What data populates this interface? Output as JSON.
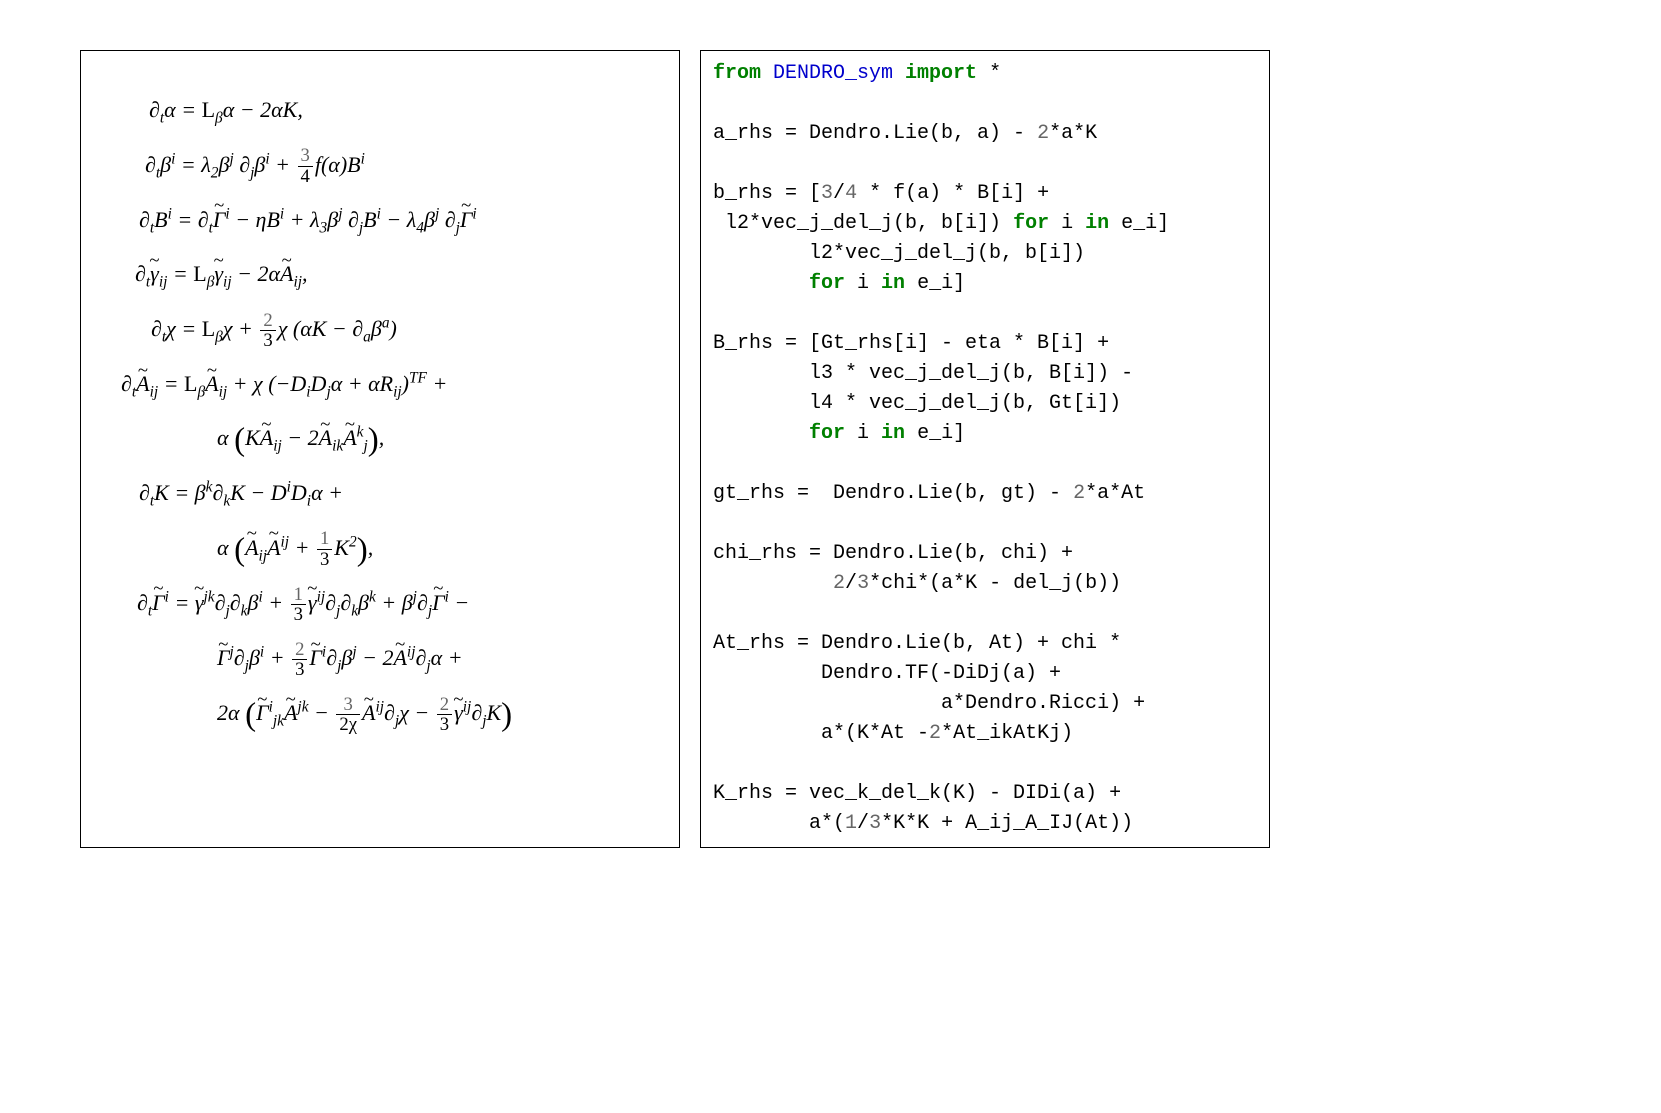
{
  "math": {
    "l1_lhs": "∂",
    "l1_t": "t",
    "l1_alpha": "α",
    "l1_eq": " = ",
    "l1_lie": "L",
    "l1_beta": "β",
    "l1_alpha2": "α − 2αK,",
    "l2_lhs": "∂",
    "l2_t": "t",
    "l2_beta": "β",
    "l2_i": "i",
    "l2_eq": " = λ",
    "l2_2": "2",
    "l2_bj": "β",
    "l2_j": "j",
    "l2_dj": " ∂",
    "l2_j2": "j",
    "l2_bi2": "β",
    "l2_i2": "i",
    "l2_plus": " + ",
    "l2_fn": "3",
    "l2_fd": "4",
    "l2_fa": "f(α)B",
    "l2_i3": "i",
    "l3_lhs": "∂",
    "l3_t": "t",
    "l3_B": "B",
    "l3_i": "i",
    "l3_eq": " = ∂",
    "l3_t2": "t",
    "l3_G": "Γ",
    "l3_i2": "i",
    "l3_mid": " − ηB",
    "l3_i3": "i",
    "l3_l3": " + λ",
    "l3_3": "3",
    "l3_bj": "β",
    "l3_j": "j",
    "l3_dj": " ∂",
    "l3_j2": "j",
    "l3_Bi": "B",
    "l3_i4": "i",
    "l3_l4": " − λ",
    "l3_4": "4",
    "l3_bj2": "β",
    "l3_j3": "j",
    "l3_dj2": " ∂",
    "l3_j4": "j",
    "l3_G2": "Γ",
    "l3_i5": "i",
    "l4_lhs": "∂",
    "l4_t": "t",
    "l4_g": "γ",
    "l4_ij": "ij",
    "l4_eq": " = ",
    "l4_lie": "L",
    "l4_beta": "β",
    "l4_g2": "γ",
    "l4_ij2": "ij",
    "l4_mid": " − 2α",
    "l4_A": "A",
    "l4_ij3": "ij",
    "l4_end": ",",
    "l5_lhs": "∂",
    "l5_t": "t",
    "l5_chi": "χ = ",
    "l5_lie": "L",
    "l5_beta": "β",
    "l5_chi2": "χ + ",
    "l5_fn": "2",
    "l5_fd": "3",
    "l5_rest": "χ (αK − ∂",
    "l5_a": "a",
    "l5_ba": "β",
    "l5_a2": "a",
    "l5_close": ")",
    "l6_lhs": "∂",
    "l6_t": "t",
    "l6_A": "A",
    "l6_ij": "ij",
    "l6_eq": " = ",
    "l6_lie": "L",
    "l6_beta": "β",
    "l6_A2": "A",
    "l6_ij2": "ij",
    "l6_mid": " + χ (−D",
    "l6_i": "i",
    "l6_D": "D",
    "l6_j": "j",
    "l6_a": "α + αR",
    "l6_ij3": "ij",
    "l6_tf": ")",
    "l6_tfsup": "TF",
    "l6_plus": " +",
    "l6b_a": "α ",
    "l6b_K": "K",
    "l6b_A": "A",
    "l6b_ij": "ij",
    "l6b_mid": " − 2",
    "l6b_A2": "A",
    "l6b_ik": "ik",
    "l6b_A3": "A",
    "l6b_k": "k",
    "l6b_j": "j",
    "l6b_end": ",",
    "l7_lhs": "∂",
    "l7_t": "t",
    "l7_K": "K = β",
    "l7_k": "k",
    "l7_dk": "∂",
    "l7_k2": "k",
    "l7_Kmid": "K − D",
    "l7_i": "i",
    "l7_D": "D",
    "l7_i2": "i",
    "l7_a": "α +",
    "l7b_a": "α ",
    "l7b_A1": "A",
    "l7b_ij": "ij",
    "l7b_A2": "A",
    "l7b_ij2": "ij",
    "l7b_plus": " + ",
    "l7b_fn": "1",
    "l7b_fd": "3",
    "l7b_K2": "K",
    "l7b_2": "2",
    "l7b_end": ",",
    "l8_lhs": "∂",
    "l8_t": "t",
    "l8_G": "Γ",
    "l8_i": "i",
    "l8_eq": " = ",
    "l8_g": "γ",
    "l8_jk": "jk",
    "l8_dj": "∂",
    "l8_j": "j",
    "l8_dk": "∂",
    "l8_k": "k",
    "l8_b": "β",
    "l8_i2": "i",
    "l8_plus": " + ",
    "l8_fn": "1",
    "l8_fd": "3",
    "l8_g2": "γ",
    "l8_ij": "ij",
    "l8_dj2": "∂",
    "l8_j2": "j",
    "l8_dk2": "∂",
    "l8_k2": "k",
    "l8_b2": "β",
    "l8_k3": "k",
    "l8_plus2": " + β",
    "l8_j3": "j",
    "l8_dj3": "∂",
    "l8_j4": "j",
    "l8_G2": "Γ",
    "l8_i3": "i",
    "l8_minus": " −",
    "l8b_G": "Γ",
    "l8b_j": "j",
    "l8b_dj": "∂",
    "l8b_j2": "j",
    "l8b_b": "β",
    "l8b_i": "i",
    "l8b_plus": " + ",
    "l8b_fn": "2",
    "l8b_fd": "3",
    "l8b_G2": "Γ",
    "l8b_i2": "i",
    "l8b_dj2": "∂",
    "l8b_j3": "j",
    "l8b_b2": "β",
    "l8b_j4": "j",
    "l8b_mid": " − 2",
    "l8b_A": "A",
    "l8b_ij": "ij",
    "l8b_dj3": "∂",
    "l8b_j5": "j",
    "l8b_a": "α +",
    "l8c_2a": "2α ",
    "l8c_G": "Γ",
    "l8c_i": "i",
    "l8c_jk": "jk",
    "l8c_A": "A",
    "l8c_jk2": "jk",
    "l8c_minus": " − ",
    "l8c_fn1": "3",
    "l8c_fd1": "2χ",
    "l8c_A2": "A",
    "l8c_ij": "ij",
    "l8c_dj": "∂",
    "l8c_j": "j",
    "l8c_chi": "χ − ",
    "l8c_fn2": "2",
    "l8c_fd2": "3",
    "l8c_g": "γ",
    "l8c_ij2": "ij",
    "l8c_dj2": "∂",
    "l8c_j2": "j",
    "l8c_K": "K"
  },
  "code": {
    "l01_from": "from ",
    "l01_mod": "DENDRO_sym ",
    "l01_import": "import ",
    "l01_star": "*",
    "l02": "",
    "l03a": "a_rhs = Dendro.Lie(b, a) - ",
    "l03n": "2",
    "l03b": "*a*K",
    "l04": "",
    "l05a": "b_rhs = [",
    "l05n1": "3",
    "l05s": "/",
    "l05n2": "4",
    "l05b": " * f(a) * B[i] +",
    "l06a": " l2*vec_j_del_j(b, b[i]) ",
    "l06for": "for",
    "l06sp": " i ",
    "l06in": "in",
    "l06b": " e_i]",
    "l07a": "        l2*vec_j_del_j(b, b[i])",
    "l08sp": "        ",
    "l08for": "for",
    "l08a": " i ",
    "l08in": "in",
    "l08b": " e_i]",
    "l09": "",
    "l10a": "B_rhs = [Gt_rhs[i] - eta * B[i] +",
    "l11a": "        l3 * vec_j_del_j(b, B[i]) -",
    "l12a": "        l4 * vec_j_del_j(b, Gt[i])",
    "l13sp": "        ",
    "l13for": "for",
    "l13a": " i ",
    "l13in": "in",
    "l13b": " e_i]",
    "l14": "",
    "l15a": "gt_rhs =  Dendro.Lie(b, gt) - ",
    "l15n": "2",
    "l15b": "*a*At",
    "l16": "",
    "l17a": "chi_rhs = Dendro.Lie(b, chi) +",
    "l18sp": "          ",
    "l18n1": "2",
    "l18s": "/",
    "l18n2": "3",
    "l18a": "*chi*(a*K - del_j(b))",
    "l19": "",
    "l20a": "At_rhs = Dendro.Lie(b, At) + chi *",
    "l21a": "         Dendro.TF(-DiDj(a) +",
    "l22a": "                   a*Dendro.Ricci) +",
    "l23sp": "         a*(K*At -",
    "l23n": "2",
    "l23a": "*At_ikAtKj)",
    "l24": "",
    "l25a": "K_rhs = vec_k_del_k(K) - DIDi(a) +",
    "l26sp": "        a*(",
    "l26n1": "1",
    "l26s": "/",
    "l26n2": "3",
    "l26a": "*K*K + A_ij_A_IJ(At))"
  }
}
